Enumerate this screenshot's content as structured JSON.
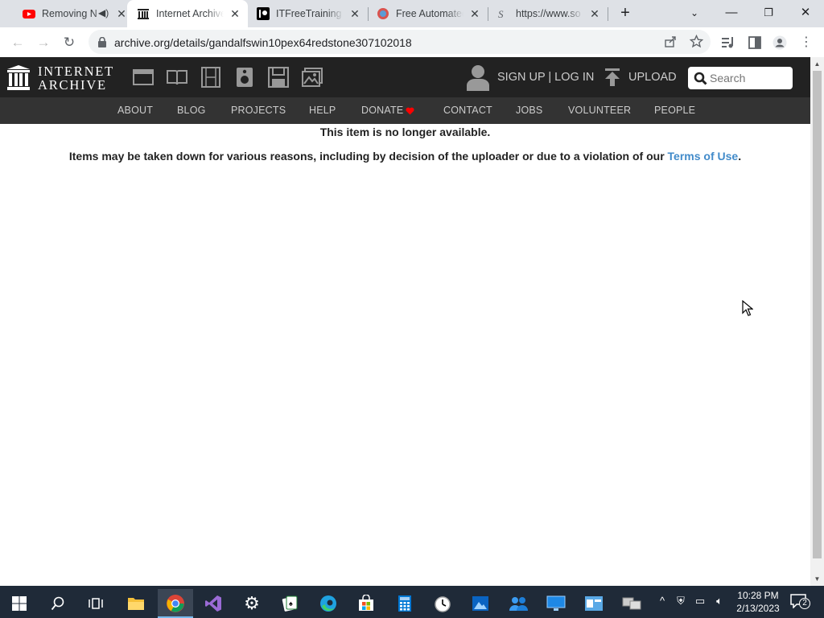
{
  "browser": {
    "tabs": [
      {
        "title": "Removing N",
        "active": false
      },
      {
        "title": "Internet Archive",
        "active": true
      },
      {
        "title": "ITFreeTraining |",
        "active": false
      },
      {
        "title": "Free Automated",
        "active": false
      },
      {
        "title": "https://www.so",
        "active": false
      }
    ],
    "url": "archive.org/details/gandalfswin10pex64redstone307102018"
  },
  "ia": {
    "logo_line1": "INTERNET",
    "logo_line2": "ARCHIVE",
    "signup_label": "SIGN UP | LOG IN",
    "upload_label": "UPLOAD",
    "search_placeholder": "Search",
    "nav": [
      "ABOUT",
      "BLOG",
      "PROJECTS",
      "HELP",
      "DONATE",
      "CONTACT",
      "JOBS",
      "VOLUNTEER",
      "PEOPLE"
    ]
  },
  "content": {
    "title": "This item is no longer available.",
    "message_prefix": "Items may be taken down for various reasons, including by decision of the uploader or due to a violation of our ",
    "terms_link": "Terms of Use",
    "message_suffix": "."
  },
  "taskbar": {
    "time": "10:28 PM",
    "date": "2/13/2023",
    "notification_count": "2"
  },
  "colors": {
    "ia_header": "#222222",
    "ia_nav": "#333333",
    "link": "#428bca",
    "donate_heart": "#ff0000",
    "taskbar": "#1f2a38"
  }
}
